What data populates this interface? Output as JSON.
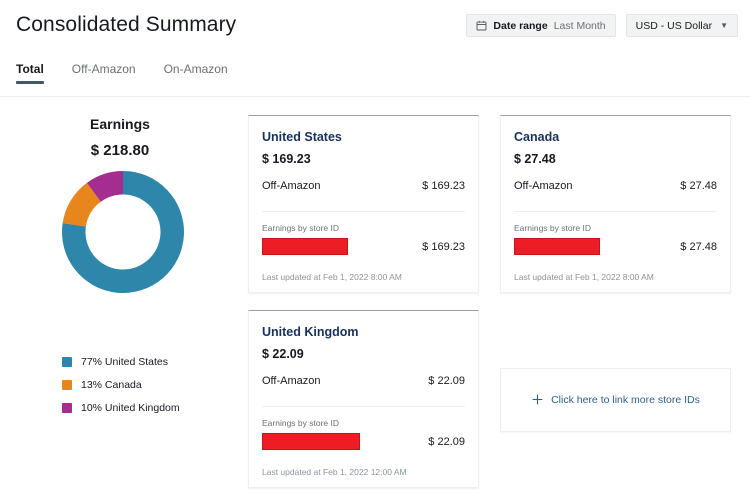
{
  "header": {
    "title": "Consolidated Summary",
    "date_range": {
      "icon": "calendar-icon",
      "label": "Date range",
      "value": "Last Month"
    },
    "currency": {
      "value": "USD - US Dollar",
      "icon": "chevron-down-icon"
    }
  },
  "tabs": [
    {
      "label": "Total",
      "active": true
    },
    {
      "label": "Off-Amazon",
      "active": false
    },
    {
      "label": "On-Amazon",
      "active": false
    }
  ],
  "chart_panel": {
    "title": "Earnings",
    "total": "$ 218.80"
  },
  "chart_data": {
    "type": "pie",
    "title": "Earnings",
    "subtitle": "$ 218.80",
    "total": 218.8,
    "legend_position": "bottom-left",
    "categories": [
      "United States",
      "Canada",
      "United Kingdom"
    ],
    "values": [
      169.23,
      27.48,
      22.09
    ],
    "percentages": [
      77,
      13,
      10
    ],
    "colors": [
      "#2e86ab",
      "#e8861e",
      "#a52d90"
    ],
    "legend": [
      {
        "swatch": "#2e86ab",
        "text": "77% United States"
      },
      {
        "swatch": "#e8861e",
        "text": "13% Canada"
      },
      {
        "swatch": "#a52d90",
        "text": "10% United Kingdom"
      }
    ],
    "donut": true,
    "start_angle": 0
  },
  "cards": [
    {
      "country": "United States",
      "amount": "$ 169.23",
      "channel_label": "Off-Amazon",
      "channel_amount": "$ 169.23",
      "store_label": "Earnings by store ID",
      "store_id": "",
      "store_amount": "$ 169.23",
      "updated": "Last updated at Feb 1, 2022 8:00 AM"
    },
    {
      "country": "Canada",
      "amount": "$ 27.48",
      "channel_label": "Off-Amazon",
      "channel_amount": "$ 27.48",
      "store_label": "Earnings by store ID",
      "store_id": "",
      "store_amount": "$ 27.48",
      "updated": "Last updated at Feb 1, 2022 8:00 AM"
    },
    {
      "country": "United Kingdom",
      "amount": "$ 22.09",
      "channel_label": "Off-Amazon",
      "channel_amount": "$ 22.09",
      "store_label": "Earnings by store ID",
      "store_id": "",
      "store_amount": "$ 22.09",
      "updated": "Last updated at Feb 1, 2022 12:00 AM"
    }
  ],
  "link_panel": {
    "icon": "plus-icon",
    "label": "Click here to link more store IDs"
  },
  "colors": {
    "accent_blue": "#2e86ab",
    "accent_orange": "#e8861e",
    "accent_magenta": "#a52d90",
    "redaction_red": "#ee1c25",
    "tab_underline": "#42566c",
    "card_title": "#16325c",
    "link_text": "#2d5f8b"
  }
}
